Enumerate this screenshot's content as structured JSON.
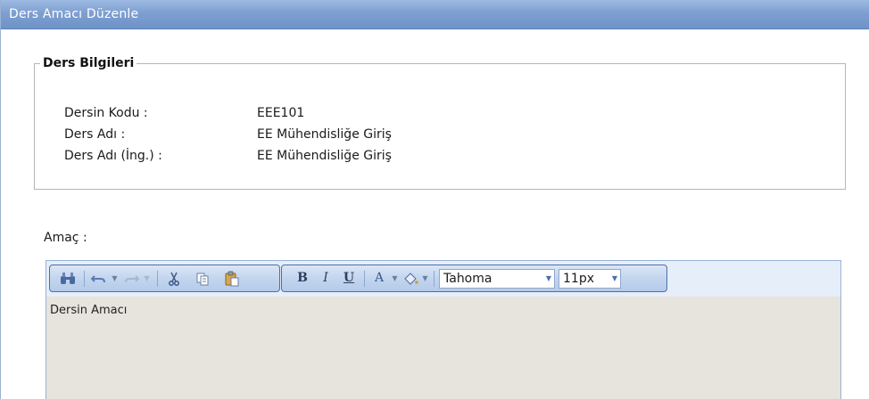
{
  "window": {
    "title": "Ders Amacı Düzenle"
  },
  "info": {
    "legend": "Ders Bilgileri",
    "rows": [
      {
        "label": "Dersin Kodu :",
        "value": "EEE101"
      },
      {
        "label": "Ders Adı :",
        "value": "EE Mühendisliğe Giriş"
      },
      {
        "label": "Ders Adı (İng.) :",
        "value": "EE Mühendisliğe Giriş"
      }
    ]
  },
  "amac": {
    "label": "Amaç :"
  },
  "editor": {
    "toolbar": {
      "find_icon": "binoculars-icon",
      "undo_icon": "undo-icon",
      "redo_icon": "redo-icon",
      "cut_icon": "scissors-icon",
      "copy_icon": "copy-icon",
      "paste_icon": "paste-icon",
      "bold": "B",
      "italic": "I",
      "underline": "U",
      "font_color": "A",
      "highlight_icon": "paint-bucket-icon",
      "font_name": "Tahoma",
      "font_size": "11px"
    },
    "content": "Dersin Amacı"
  },
  "colors": {
    "titlebar": "#7e9fd0",
    "toolbar_border": "#4d6fa8",
    "editor_bg": "#e6e4dc"
  }
}
